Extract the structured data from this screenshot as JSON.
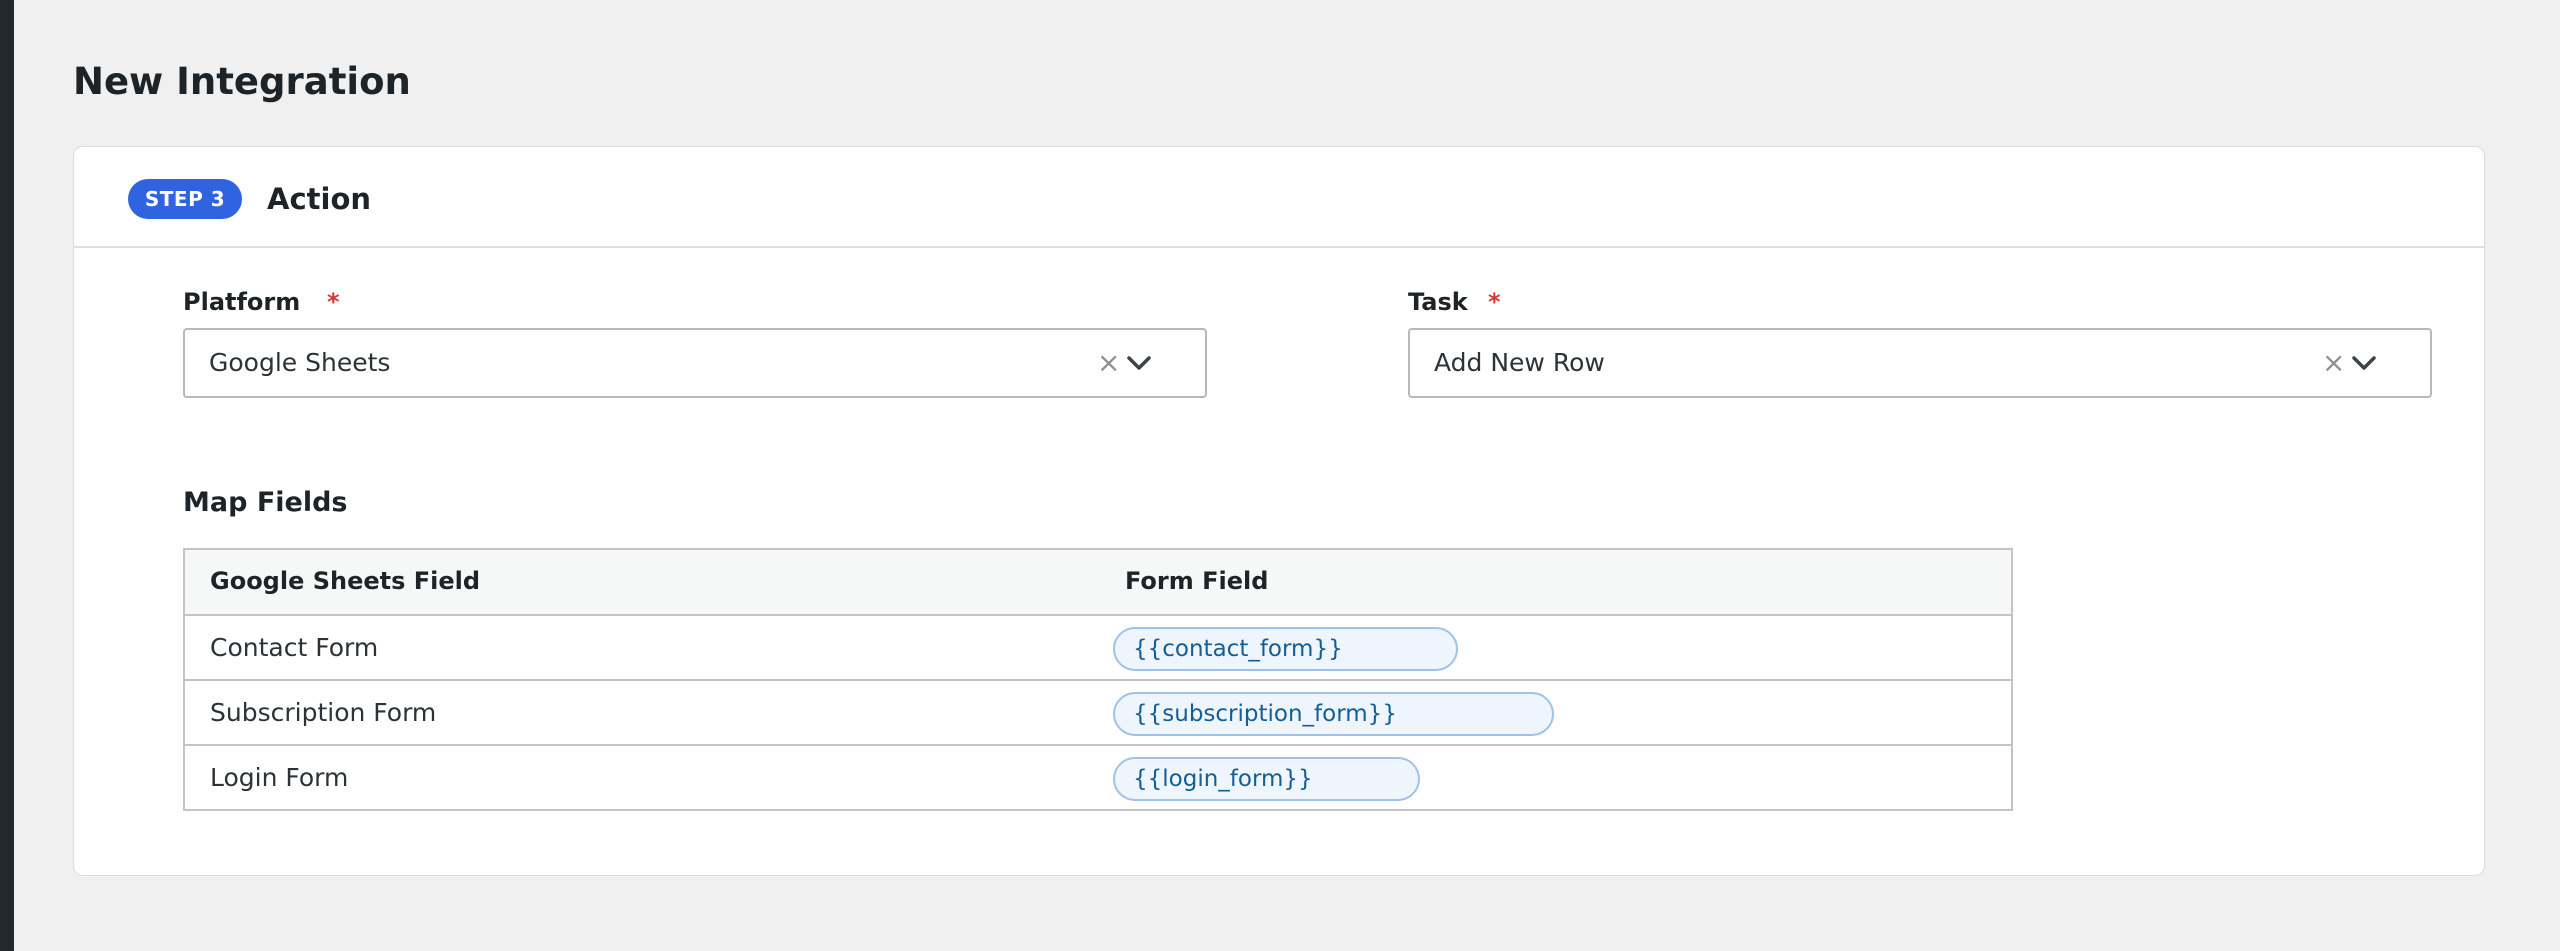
{
  "page": {
    "title": "New Integration"
  },
  "step": {
    "badge": "STEP 3",
    "title": "Action"
  },
  "platform": {
    "label": "Platform",
    "required_mark": "*",
    "value": "Google Sheets",
    "clear_icon": "×"
  },
  "task": {
    "label": "Task",
    "required_mark": "*",
    "value": "Add New Row",
    "clear_icon": "×"
  },
  "map_fields": {
    "title": "Map Fields",
    "columns": [
      "Google Sheets Field",
      "Form Field"
    ],
    "rows": [
      {
        "sheet_field": "Contact Form",
        "form_field": "{{contact_form}}"
      },
      {
        "sheet_field": "Subscription Form",
        "form_field": "{{subscription_form}}"
      },
      {
        "sheet_field": "Login Form",
        "form_field": "{{login_form}}"
      }
    ]
  },
  "colors": {
    "accent": "#2f63e0",
    "required": "#d63638",
    "token_text": "#135e96",
    "token_bg": "#eef5fc"
  }
}
